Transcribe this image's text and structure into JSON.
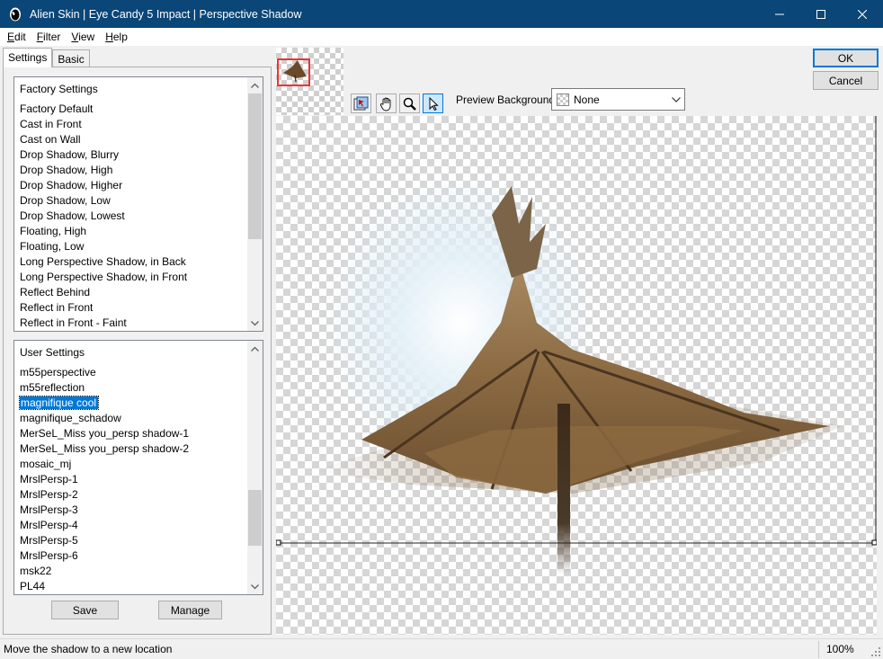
{
  "window": {
    "title": "Alien Skin | Eye Candy 5 Impact | Perspective Shadow",
    "icon": "alien-skin-logo-icon"
  },
  "menu": [
    {
      "label": "Edit",
      "accel": "E"
    },
    {
      "label": "Filter",
      "accel": "F"
    },
    {
      "label": "View",
      "accel": "V"
    },
    {
      "label": "Help",
      "accel": "H"
    }
  ],
  "tabs": [
    {
      "label": "Settings",
      "active": true
    },
    {
      "label": "Basic",
      "active": false
    }
  ],
  "factory_settings": {
    "header": "Factory Settings",
    "items": [
      "Factory Default",
      "Cast in Front",
      "Cast on Wall",
      "Drop Shadow, Blurry",
      "Drop Shadow, High",
      "Drop Shadow, Higher",
      "Drop Shadow, Low",
      "Drop Shadow, Lowest",
      "Floating, High",
      "Floating, Low",
      "Long Perspective Shadow, in Back",
      "Long Perspective Shadow, in Front",
      "Reflect Behind",
      "Reflect in Front",
      "Reflect in Front - Faint"
    ]
  },
  "user_settings": {
    "header": "User Settings",
    "selected": "magnifique cool",
    "items": [
      "m55perspective",
      "m55reflection",
      "magnifique cool",
      "magnifique_schadow",
      "MerSeL_Miss you_persp shadow-1",
      "MerSeL_Miss you_persp shadow-2",
      "mosaic_mj",
      "MrslPersp-1",
      "MrslPersp-2",
      "MrslPersp-3",
      "MrslPersp-4",
      "MrslPersp-5",
      "MrslPersp-6",
      "msk22",
      "PL44"
    ]
  },
  "buttons": {
    "save": "Save",
    "manage": "Manage",
    "ok": "OK",
    "cancel": "Cancel"
  },
  "tools": [
    {
      "name": "navigate-tool-icon",
      "active": false
    },
    {
      "name": "hand-pan-icon",
      "active": false
    },
    {
      "name": "zoom-magnifier-icon",
      "active": false
    },
    {
      "name": "pointer-arrow-icon",
      "active": true
    }
  ],
  "preview_background": {
    "label": "Preview Background:",
    "value": "None"
  },
  "status": {
    "message": "Move the shadow to a new location",
    "zoom": "100%"
  },
  "colors": {
    "titlebar": "#0a4678",
    "selection": "#0078d7",
    "accent_border": "#0078d7"
  }
}
